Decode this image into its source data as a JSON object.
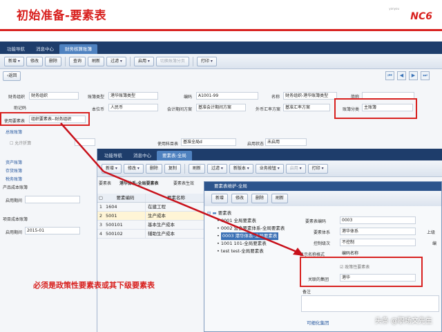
{
  "slide": {
    "title": "初始准备-要素表",
    "brand_small": "yonyou",
    "brand": "NC6",
    "annotation": "必须是政策性要素表或其下级要素表",
    "watermark": "头条 @职场文先生"
  },
  "win1": {
    "tabs": [
      "功能导航",
      "消息中心",
      "财务核算账簿"
    ],
    "toolbar": [
      "新增",
      "修改",
      "删除",
      "查询",
      "刷新",
      "过滤",
      "启用",
      "切换账簿分页",
      "打印"
    ],
    "back": "返回",
    "labels": {
      "org": "财务组织",
      "book_type": "账簿类型",
      "code": "编码",
      "name": "名称",
      "shortname": "简称",
      "mnemonic": "助记码",
      "currency": "本位币",
      "period": "会计期间方案",
      "rate": "外币汇率方案",
      "book_cat": "账簿分类",
      "elem_table": "使用要素表",
      "enable_subject": "使用科目表",
      "status": "启用状态"
    },
    "values": {
      "org": "财务组织",
      "book_type": "港华账簿类型",
      "code": "A1001-99",
      "name": "财务组织-港华账簿类型",
      "currency": "人民币",
      "period": "基准会计期间方案",
      "rate": "基准汇率方案",
      "book_cat": "主账簿",
      "elem_table": "组织要素表--财务组织",
      "subject": "基准全局d",
      "status": "未启用"
    },
    "sections": [
      "总账账簿",
      "允许折算",
      "资产账簿",
      "存货账簿",
      "税务账簿",
      "产品成本账簿",
      "启用期间",
      "项目成本账簿",
      "启用期间"
    ],
    "enable_period": "2015-01"
  },
  "win2": {
    "tabs": [
      "功能导航",
      "消息中心",
      "要素表-全局"
    ],
    "toolbar": [
      "新增",
      "修改",
      "删除",
      "复制",
      "刷新",
      "过滤",
      "新版本",
      "业务按钮",
      "启用",
      "打印"
    ],
    "elem_label": "要素表",
    "elem_value": "港华体系-全局要素表",
    "elem_label2": "要素表生效",
    "grid_headers": [
      "要素编码",
      "要素名称"
    ],
    "rows": [
      {
        "n": "1",
        "code": "1604",
        "name": "在建工程"
      },
      {
        "n": "2",
        "code": "5001",
        "name": "生产成本"
      },
      {
        "n": "3",
        "code": "500101",
        "name": "基本生产成本"
      },
      {
        "n": "4",
        "code": "500102",
        "name": "辅助生产成本"
      }
    ]
  },
  "dialog": {
    "title": "要素表维护-全局",
    "buttons": [
      "新增",
      "修改",
      "删除",
      "刷新"
    ],
    "tree_root": "要素表",
    "tree": [
      "0001 全局要素表",
      "0002 营会要素体系-全局要素表",
      "0003 港华体系-全局要素表",
      "1001 101-全局要素表",
      "test test-全局要素表"
    ],
    "labels": {
      "code": "要素表编码",
      "system": "要素体系",
      "control": "控制级次",
      "display": "显示名称格式",
      "policy": "政策性要素表",
      "group": "关联的集团",
      "note": "备注",
      "detail_tab": "可细化集团",
      "extra": "上级",
      "extra2": "编"
    },
    "values": {
      "code": "0003",
      "system": "港华体系",
      "control": "不控制",
      "display": "编码名称",
      "group": "港华"
    }
  }
}
